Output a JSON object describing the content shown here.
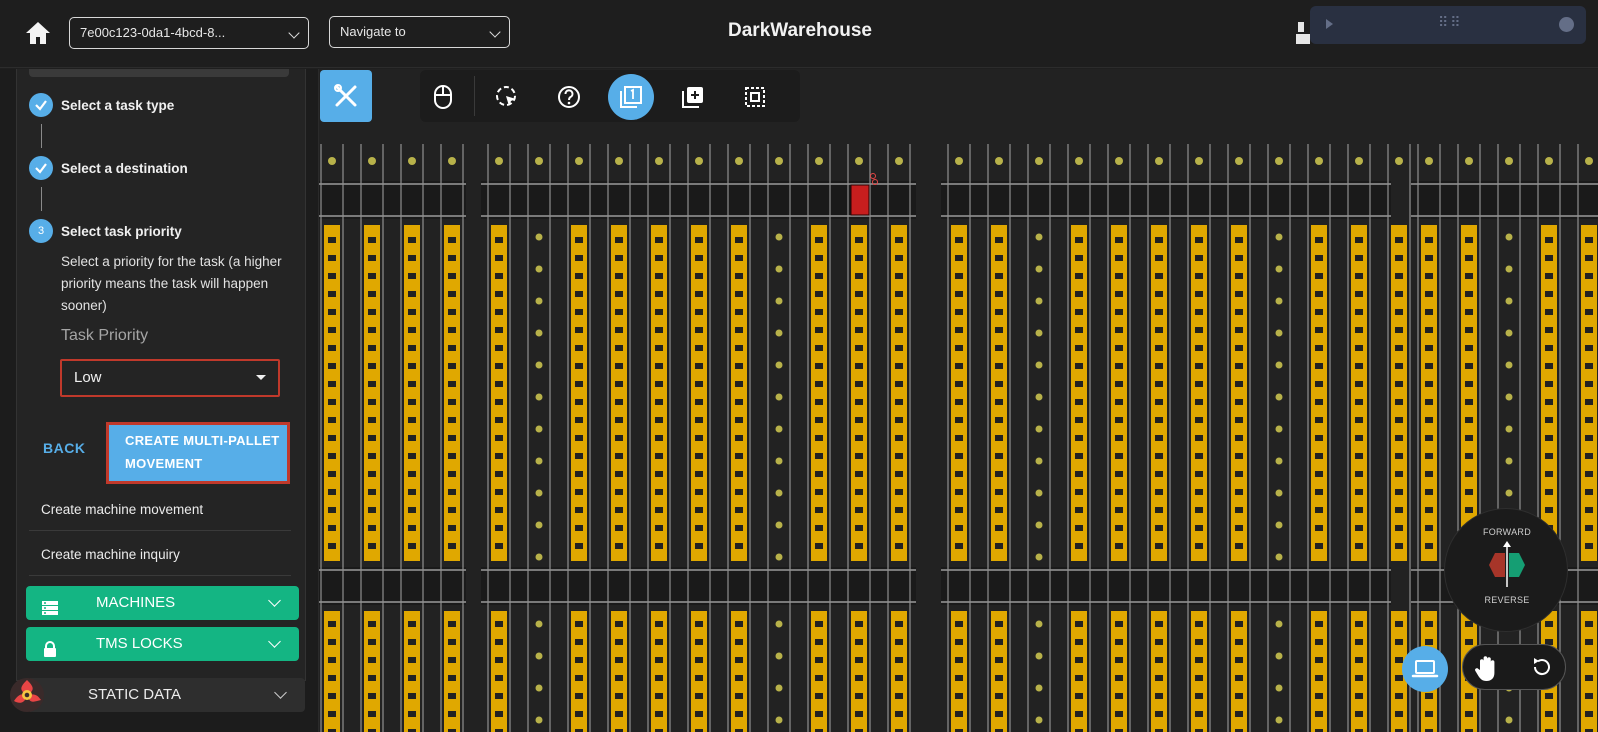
{
  "header": {
    "app_title": "DarkWarehouse",
    "warehouse_select_value": "7e00c123-0da1-4bcd-8...",
    "navigate_placeholder": "Navigate to"
  },
  "stepper": {
    "steps": [
      {
        "label": "Select a task type",
        "state": "done"
      },
      {
        "label": "Select a destination",
        "state": "done"
      },
      {
        "label": "Select task priority",
        "state": "active",
        "number": "3"
      }
    ],
    "description": "Select a priority for the task (a higher priority means the task will happen sooner)",
    "field_label": "Task Priority",
    "priority_value": "Low",
    "back_label": "BACK",
    "create_label": "CREATE MULTI-PALLET MOVEMENT"
  },
  "menu": {
    "items": [
      "Create machine movement",
      "Create machine inquiry"
    ],
    "accordions": [
      {
        "label": "MACHINES",
        "icon": "server-icon"
      },
      {
        "label": "TMS LOCKS",
        "icon": "lock-icon"
      }
    ],
    "static_data_label": "STATIC DATA"
  },
  "compass": {
    "forward_label": "FORWARD",
    "reverse_label": "REVERSE"
  },
  "colors": {
    "accent": "#57aee8",
    "green": "#14b583",
    "danger": "#c0392b",
    "pallet": "#e0a800",
    "background": "#1f1f1f"
  }
}
